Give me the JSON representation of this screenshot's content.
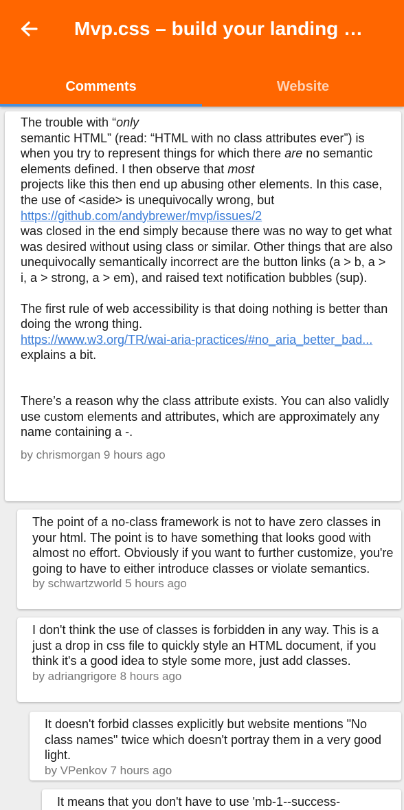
{
  "header": {
    "title": "Mvp.css – build your landing …",
    "back_icon": "arrow-back-icon",
    "bg_color": "#ff6600"
  },
  "tabs": [
    {
      "label": "Comments",
      "active": true
    },
    {
      "label": "Website",
      "active": false
    }
  ],
  "comments": [
    {
      "p1_a": "The trouble with “",
      "p1_b": "only",
      "p1_c": "semantic HTML” (read: “HTML with no class attributes ever”) is when you try to represent things for which there",
      "p1_d": "are",
      "p1_e": " no semantic elements defined. I then observe that ",
      "p1_f": "most",
      "p1_g": "projects like this then end up abusing other elements. In this case, the use of <aside> is unequivocally wrong, but",
      "link1": "https://github.com/andybrewer/mvp/issues/2",
      "p1_h": "was closed in the end simply because there was no way to get what was desired without using class or similar. Other things that are also unequivocally semantically incorrect are the button links (a > b, a > i, a > strong, a > em), and raised text notification bubbles (sup).",
      "p2_a": "The first rule of web accessibility is that doing nothing is better than doing the wrong thing.",
      "link2": "https://www.w3.org/TR/wai-aria-practices/#no_aria_better_bad...",
      "p2_b": "explains a bit.",
      "p3": "There’s a reason why the class attribute exists. You can also validly use custom elements and attributes, which are approximately any name containing a -.",
      "meta": "by chrismorgan 9 hours ago"
    },
    {
      "text": "The point of a no-class framework is not to have zero classes in your html. The point is to have something that looks good with almost no effort. Obviously if you want to further customize, you're going to have to either introduce classes or violate semantics.",
      "meta": "by schwartzworld 5 hours ago"
    },
    {
      "text": "I don't think the use of classes is forbidden in any way. This is a just a drop in css file to quickly style an HTML document, if you think it's a good idea to style some more, just add classes.",
      "meta": "by adriangrigore 8 hours ago"
    },
    {
      "text": "It doesn't forbid classes explicitly but website mentions \"No class names\" twice which doesn't portray them in a very good light.",
      "meta": "by VPenkov 7 hours ago"
    },
    {
      "text": "It means that you don't have to use 'mb-1--success-"
    }
  ]
}
